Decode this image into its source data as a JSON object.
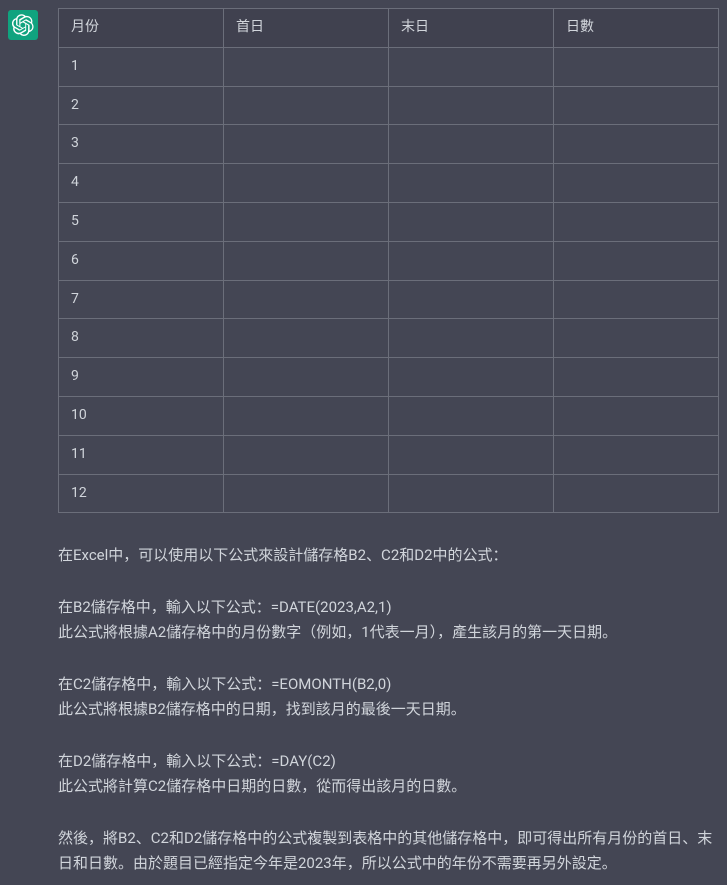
{
  "table": {
    "headers": [
      "月份",
      "首日",
      "末日",
      "日數"
    ],
    "rows": [
      [
        "1",
        "",
        "",
        ""
      ],
      [
        "2",
        "",
        "",
        ""
      ],
      [
        "3",
        "",
        "",
        ""
      ],
      [
        "4",
        "",
        "",
        ""
      ],
      [
        "5",
        "",
        "",
        ""
      ],
      [
        "6",
        "",
        "",
        ""
      ],
      [
        "7",
        "",
        "",
        ""
      ],
      [
        "8",
        "",
        "",
        ""
      ],
      [
        "9",
        "",
        "",
        ""
      ],
      [
        "10",
        "",
        "",
        ""
      ],
      [
        "11",
        "",
        "",
        ""
      ],
      [
        "12",
        "",
        "",
        ""
      ]
    ]
  },
  "paragraphs": {
    "intro": "在Excel中，可以使用以下公式來設計儲存格B2、C2和D2中的公式：",
    "b2_line1": "在B2儲存格中，輸入以下公式：=DATE(2023,A2,1)",
    "b2_line2": "此公式將根據A2儲存格中的月份數字（例如，1代表一月），產生該月的第一天日期。",
    "c2_line1": "在C2儲存格中，輸入以下公式：=EOMONTH(B2,0)",
    "c2_line2": "此公式將根據B2儲存格中的日期，找到該月的最後一天日期。",
    "d2_line1": "在D2儲存格中，輸入以下公式：=DAY(C2)",
    "d2_line2": "此公式將計算C2儲存格中日期的日數，從而得出該月的日數。",
    "summary": "然後，將B2、C2和D2儲存格中的公式複製到表格中的其他儲存格中，即可得出所有月份的首日、末日和日數。由於題目已經指定今年是2023年，所以公式中的年份不需要再另外設定。"
  }
}
